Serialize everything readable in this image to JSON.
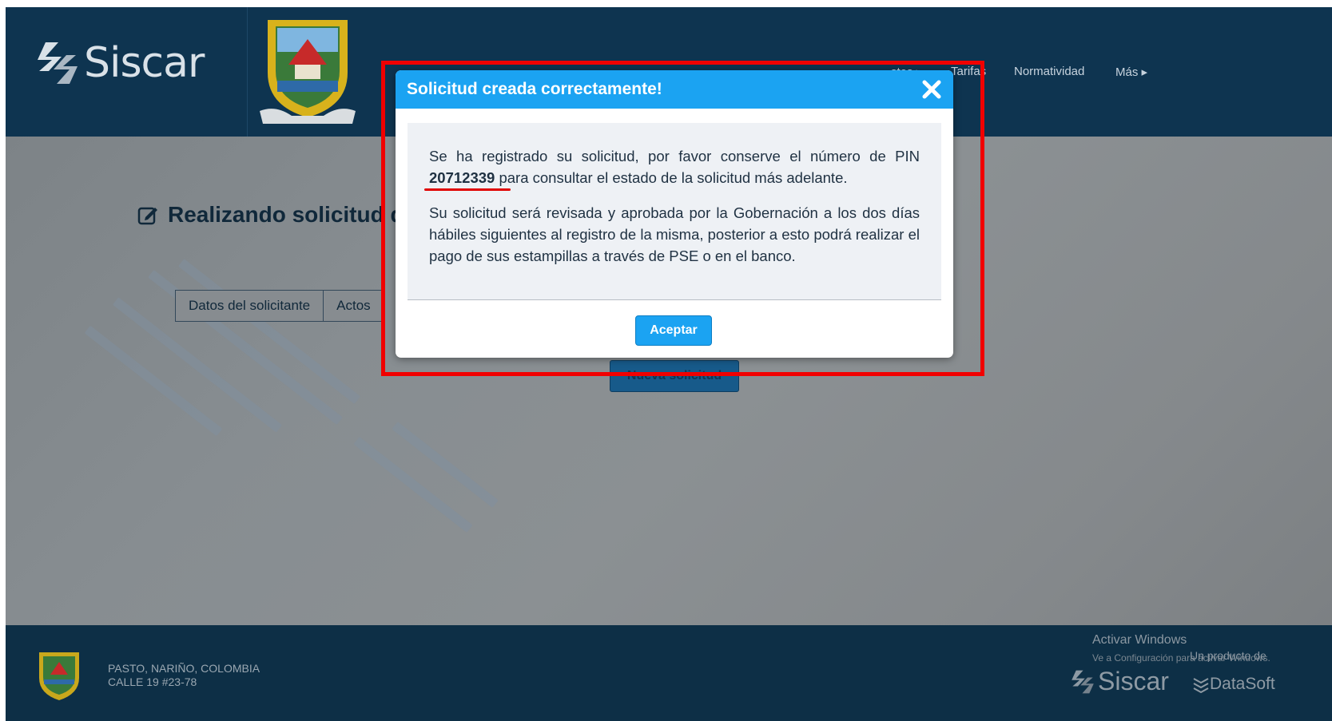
{
  "header": {
    "brand": "Siscar",
    "nav": {
      "impuestos_partial": "stos",
      "tarifas": "Tarifas",
      "normatividad": "Normatividad",
      "mas": "Más"
    }
  },
  "main": {
    "page_title_partial": "Realizando solicitud d",
    "tabs": [
      "Datos del solicitante",
      "Actos"
    ],
    "bg_button": "Nueva solicitud"
  },
  "modal": {
    "title": "Solicitud creada correctamente!",
    "p1_before_pin": "Se ha registrado su solicitud, por favor conserve el número de PIN ",
    "pin": "20712339",
    "p1_after_pin": " para consultar el estado de la solicitud más adelante.",
    "p2": "Su solicitud será revisada y aprobada por la Gobernación a los dos días hábiles siguientes al registro de la misma, posterior a esto podrá realizar el pago de sus estampillas a través de PSE o en el banco.",
    "accept_label": "Aceptar"
  },
  "footer": {
    "address_line1": "PASTO, NARIÑO, COLOMBIA",
    "address_line2": "CALLE 19 #23-78",
    "activate_title": "Activar Windows",
    "activate_sub": "Ve a Configuración para activar Windows.",
    "producto_label": "Un producto de",
    "brand": "Siscar",
    "datasoft": "DataSoft"
  },
  "colors": {
    "header_bg": "#0e3450",
    "modal_header": "#1ba3f2",
    "highlight_border": "#f10000",
    "footer_bg": "#0d2f46"
  }
}
